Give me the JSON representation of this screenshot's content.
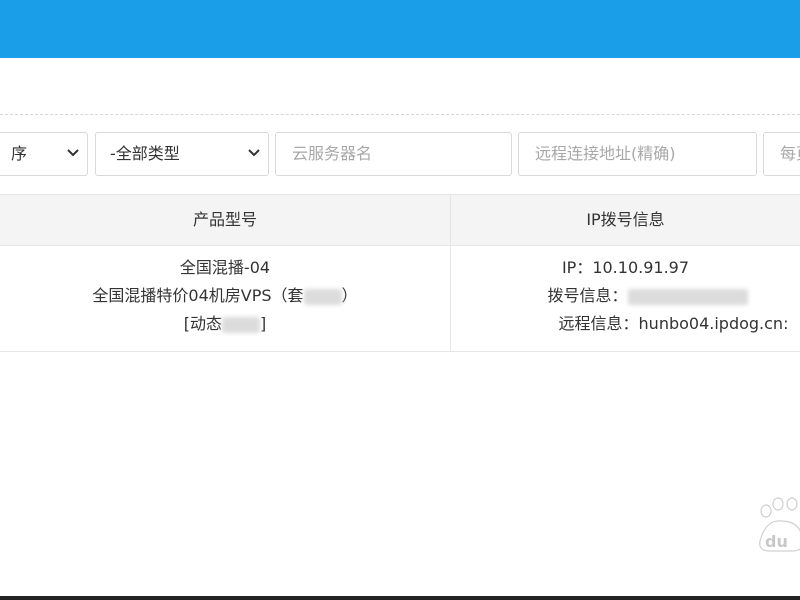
{
  "colors": {
    "topbar": "#1b9ee8",
    "placeholder": "#a8a8a8",
    "header_bg": "#f4f4f4",
    "border": "#d9d9d9"
  },
  "filters": {
    "sort_select_value": "序",
    "type_select_value": "-全部类型",
    "server_name_placeholder": "云服务器名",
    "remote_address_placeholder": "远程连接地址(精确)",
    "last_field_placeholder": "每页"
  },
  "table": {
    "headers": [
      "产品型号",
      "IP拨号信息"
    ],
    "rows": [
      {
        "product_name": "全国混播-04",
        "product_desc": "全国混播特价04机房VPS（套",
        "product_desc_end": "）",
        "product_status_open": "[动态",
        "product_status_close": "]",
        "ip_line": "IP：10.10.91.97",
        "dial_label": "拨号信息：",
        "remote_line": "远程信息：hunbo04.ipdog.cn:"
      }
    ]
  },
  "watermark": {
    "icon": "baidu-paw-icon",
    "text": "du"
  }
}
